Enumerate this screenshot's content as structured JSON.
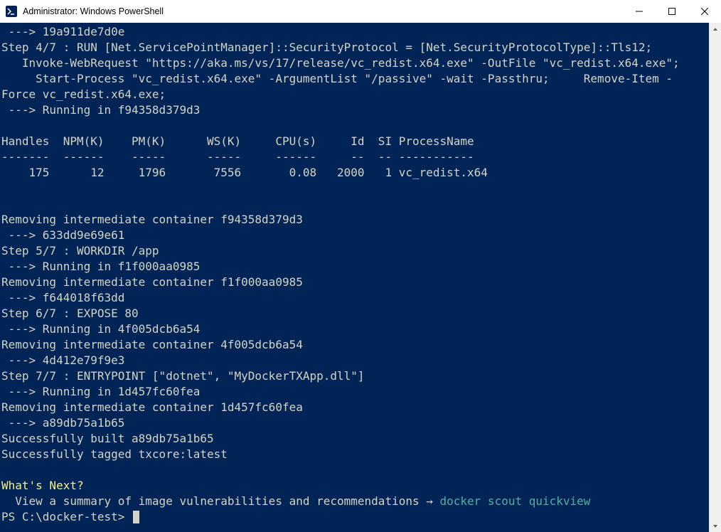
{
  "window": {
    "title": "Administrator: Windows PowerShell"
  },
  "terminal": {
    "lines": [
      " ---> 19a911de7d0e",
      "Step 4/7 : RUN [Net.ServicePointManager]::SecurityProtocol = [Net.SecurityProtocolType]::Tls12;",
      "   Invoke-WebRequest \"https://aka.ms/vs/17/release/vc_redist.x64.exe\" -OutFile \"vc_redist.x64.exe\";",
      "     Start-Process \"vc_redist.x64.exe\" -ArgumentList \"/passive\" -wait -Passthru;     Remove-Item -",
      "Force vc_redist.x64.exe;",
      " ---> Running in f94358d379d3",
      "",
      "Handles  NPM(K)    PM(K)      WS(K)     CPU(s)     Id  SI ProcessName",
      "-------  ------    -----      -----     ------     --  -- -----------",
      "    175      12     1796       7556       0.08   2000   1 vc_redist.x64",
      "",
      "",
      "Removing intermediate container f94358d379d3",
      " ---> 633dd9e69e61",
      "Step 5/7 : WORKDIR /app",
      " ---> Running in f1f000aa0985",
      "Removing intermediate container f1f000aa0985",
      " ---> f644018f63dd",
      "Step 6/7 : EXPOSE 80",
      " ---> Running in 4f005dcb6a54",
      "Removing intermediate container 4f005dcb6a54",
      " ---> 4d412e79f9e3",
      "Step 7/7 : ENTRYPOINT [\"dotnet\", \"MyDockerTXApp.dll\"]",
      " ---> Running in 1d457fc60fea",
      "Removing intermediate container 1d457fc60fea",
      " ---> a89db75a1b65",
      "Successfully built a89db75a1b65",
      "Successfully tagged txcore:latest",
      ""
    ],
    "whats_next_label": "What's Next?",
    "whats_next_line_prefix": "  View a summary of image vulnerabilities and recommendations → ",
    "whats_next_command": "docker scout quickview",
    "prompt": "PS C:\\docker-test> "
  }
}
